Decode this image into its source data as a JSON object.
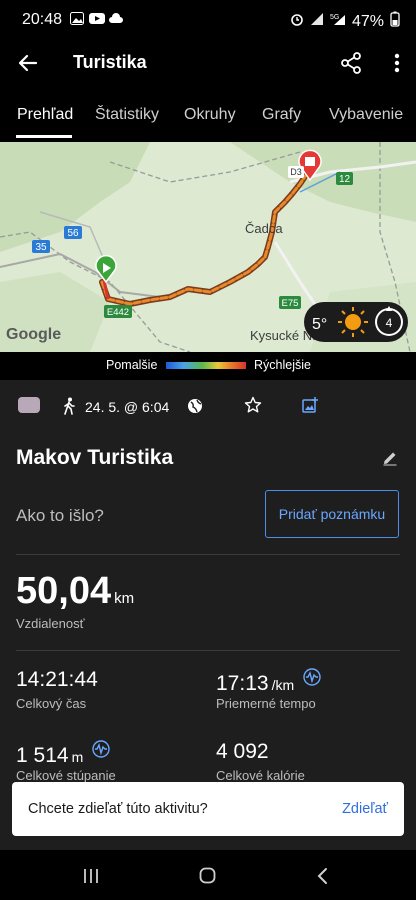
{
  "status": {
    "time": "20:48",
    "battery": "47%"
  },
  "appbar": {
    "title": "Turistika"
  },
  "tabs": [
    {
      "label": "Prehľad"
    },
    {
      "label": "Štatistiky"
    },
    {
      "label": "Okruhy"
    },
    {
      "label": "Grafy"
    },
    {
      "label": "Vybavenie"
    }
  ],
  "map": {
    "labels": {
      "city": "Čadca",
      "town": "Kysucké N...",
      "brand": "Google"
    },
    "roads": {
      "r12": "12",
      "r56": "56",
      "r35": "35",
      "e442": "E442",
      "e75": "E75",
      "d3": "D3"
    },
    "weather": {
      "temp": "5°",
      "wind": "4"
    }
  },
  "legend": {
    "slow": "Pomalšie",
    "fast": "Rýchlejšie"
  },
  "info": {
    "date": "24. 5. @ 6:04"
  },
  "activity": {
    "name": "Makov Turistika",
    "prompt": "Ako to išlo?",
    "add_note": "Pridať poznámku"
  },
  "stats": {
    "distance": {
      "value": "50,04",
      "unit": "km",
      "label": "Vzdialenosť"
    },
    "total_time": {
      "value": "14:21:44",
      "label": "Celkový čas"
    },
    "avg_pace": {
      "value": "17:13",
      "unit": "/km",
      "label": "Priemerné tempo"
    },
    "ascent": {
      "value": "1 514",
      "unit": "m",
      "label": "Celkové stúpanie"
    },
    "calories": {
      "value": "4 092",
      "label": "Celkové kalórie"
    }
  },
  "snackbar": {
    "message": "Chcete zdieľať túto aktivitu?",
    "action": "Zdieľať"
  },
  "colors": {
    "accent": "#4d8ce8",
    "route_start": "#3aa63a",
    "route_end": "#e53935"
  }
}
